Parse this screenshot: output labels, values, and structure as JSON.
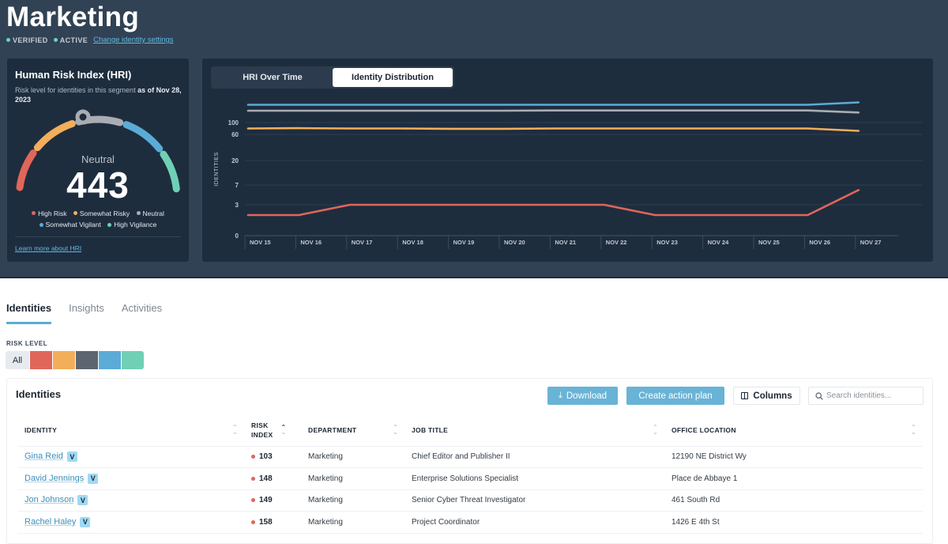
{
  "header": {
    "title": "Marketing",
    "statuses": [
      "VERIFIED",
      "ACTIVE"
    ],
    "settings_link": "Change identity settings"
  },
  "hri": {
    "title": "Human Risk Index (HRI)",
    "subtitle_prefix": "Risk level for identities in this segment",
    "subtitle_date": "as of Nov 28, 2023",
    "level": "Neutral",
    "score": "443",
    "legend": [
      {
        "label": "High Risk",
        "color": "#e0665a"
      },
      {
        "label": "Somewhat Risky",
        "color": "#f2ae5b"
      },
      {
        "label": "Neutral",
        "color": "#a9adb3"
      },
      {
        "label": "Somewhat Vigilant",
        "color": "#5aacd6"
      },
      {
        "label": "High Vigilance",
        "color": "#6fd0b5"
      }
    ],
    "learn_more": "Learn more about HRI"
  },
  "chart_tabs": [
    {
      "label": "HRI Over Time",
      "active": false
    },
    {
      "label": "Identity Distribution",
      "active": true
    }
  ],
  "chart_data": {
    "type": "line",
    "title": "Identity Distribution",
    "xlabel": "",
    "ylabel": "IDENTITIES",
    "x": [
      "NOV 15",
      "NOV 16",
      "NOV 17",
      "NOV 18",
      "NOV 19",
      "NOV 20",
      "NOV 21",
      "NOV 22",
      "NOV 23",
      "NOV 24",
      "NOV 25",
      "NOV 26",
      "NOV 27"
    ],
    "y_ticks": [
      0,
      3,
      7,
      20,
      60,
      100
    ],
    "y_scale": "nonlinear",
    "grid": true,
    "legend": "none",
    "series": [
      {
        "name": "Somewhat Vigilant",
        "color": "#5aacd6",
        "values": [
          250,
          250,
          250,
          250,
          250,
          250,
          250,
          250,
          250,
          250,
          250,
          250,
          270
        ]
      },
      {
        "name": "Neutral",
        "color": "#a9adb3",
        "values": [
          200,
          200,
          200,
          200,
          200,
          200,
          202,
          202,
          202,
          202,
          202,
          202,
          185
        ]
      },
      {
        "name": "Somewhat Risky",
        "color": "#f2ae5b",
        "values": [
          80,
          81,
          80,
          80,
          79,
          79,
          80,
          80,
          80,
          80,
          80,
          80,
          72
        ]
      },
      {
        "name": "High Risk",
        "color": "#e0665a",
        "values": [
          2,
          2,
          3,
          3,
          3,
          3,
          3,
          3,
          2,
          2,
          2,
          2,
          6
        ]
      }
    ]
  },
  "tabs": [
    {
      "label": "Identities",
      "active": true
    },
    {
      "label": "Insights",
      "active": false
    },
    {
      "label": "Activities",
      "active": false
    }
  ],
  "risk_filter": {
    "label": "RISK LEVEL",
    "all_label": "All",
    "swatches": [
      "#e0665a",
      "#f2ae5b",
      "#5d6570",
      "#5aacd6",
      "#6fd0b5"
    ]
  },
  "table": {
    "title": "Identities",
    "download_label": "Download",
    "action_plan_label": "Create action plan",
    "columns_label": "Columns",
    "search_placeholder": "Search identities...",
    "headers": [
      "IDENTITY",
      "RISK\nINDEX",
      "DEPARTMENT",
      "JOB TITLE",
      "OFFICE LOCATION"
    ],
    "badge": "V",
    "risk_dot_color": "#e0665a",
    "rows": [
      {
        "name": "Gina Reid",
        "risk": "103",
        "department": "Marketing",
        "job_title": "Chief Editor and Publisher II",
        "office": "12190 NE District Wy"
      },
      {
        "name": "David Jennings",
        "risk": "148",
        "department": "Marketing",
        "job_title": "Enterprise Solutions Specialist",
        "office": "Place de Abbaye 1"
      },
      {
        "name": "Jon Johnson",
        "risk": "149",
        "department": "Marketing",
        "job_title": "Senior Cyber Threat Investigator",
        "office": "461 South Rd"
      },
      {
        "name": "Rachel Haley",
        "risk": "158",
        "department": "Marketing",
        "job_title": "Project Coordinator",
        "office": "1426 E 4th St"
      }
    ]
  }
}
